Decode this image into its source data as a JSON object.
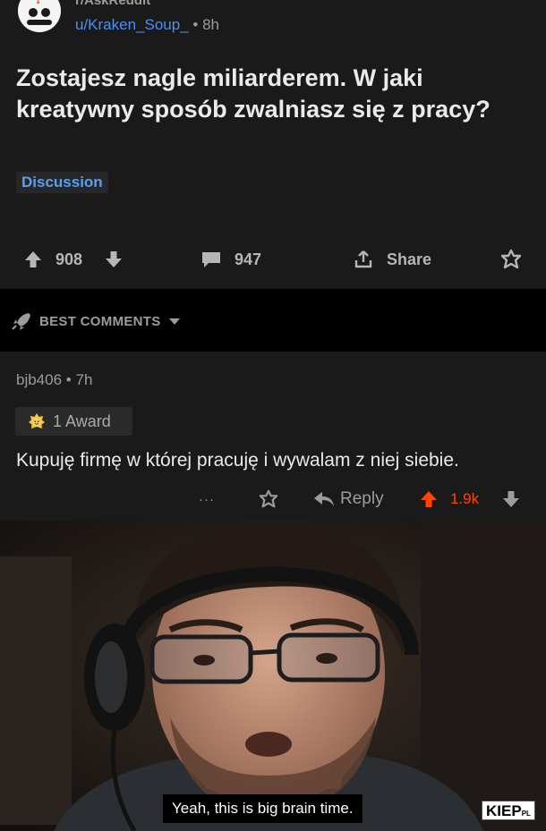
{
  "post": {
    "subreddit": "r/AskReddit",
    "author": "u/Kraken_Soup_",
    "separator": "•",
    "age": "8h",
    "title": "Zostajesz nagle miliarderem. W jaki kreatywny sposób zwalniasz się z pracy?",
    "flair": "Discussion",
    "upvotes": "908",
    "comments": "947",
    "share_label": "Share"
  },
  "sort": {
    "label": "BEST COMMENTS"
  },
  "comment": {
    "author": "bjb406",
    "separator": "•",
    "age": "7h",
    "award_label": "1 Award",
    "body": "Kupuję firmę w której pracuję i wywalam z niej siebie.",
    "more": "···",
    "reply_label": "Reply",
    "score": "1.9k"
  },
  "meme": {
    "subtitle": "Yeah, this is big brain time.",
    "watermark": "KIEP",
    "watermark_suffix": "PL"
  },
  "colors": {
    "background": "#1a1a1b",
    "link": "#4f8ff0",
    "upvoted": "#ff4500",
    "muted": "#9a9c9e"
  }
}
